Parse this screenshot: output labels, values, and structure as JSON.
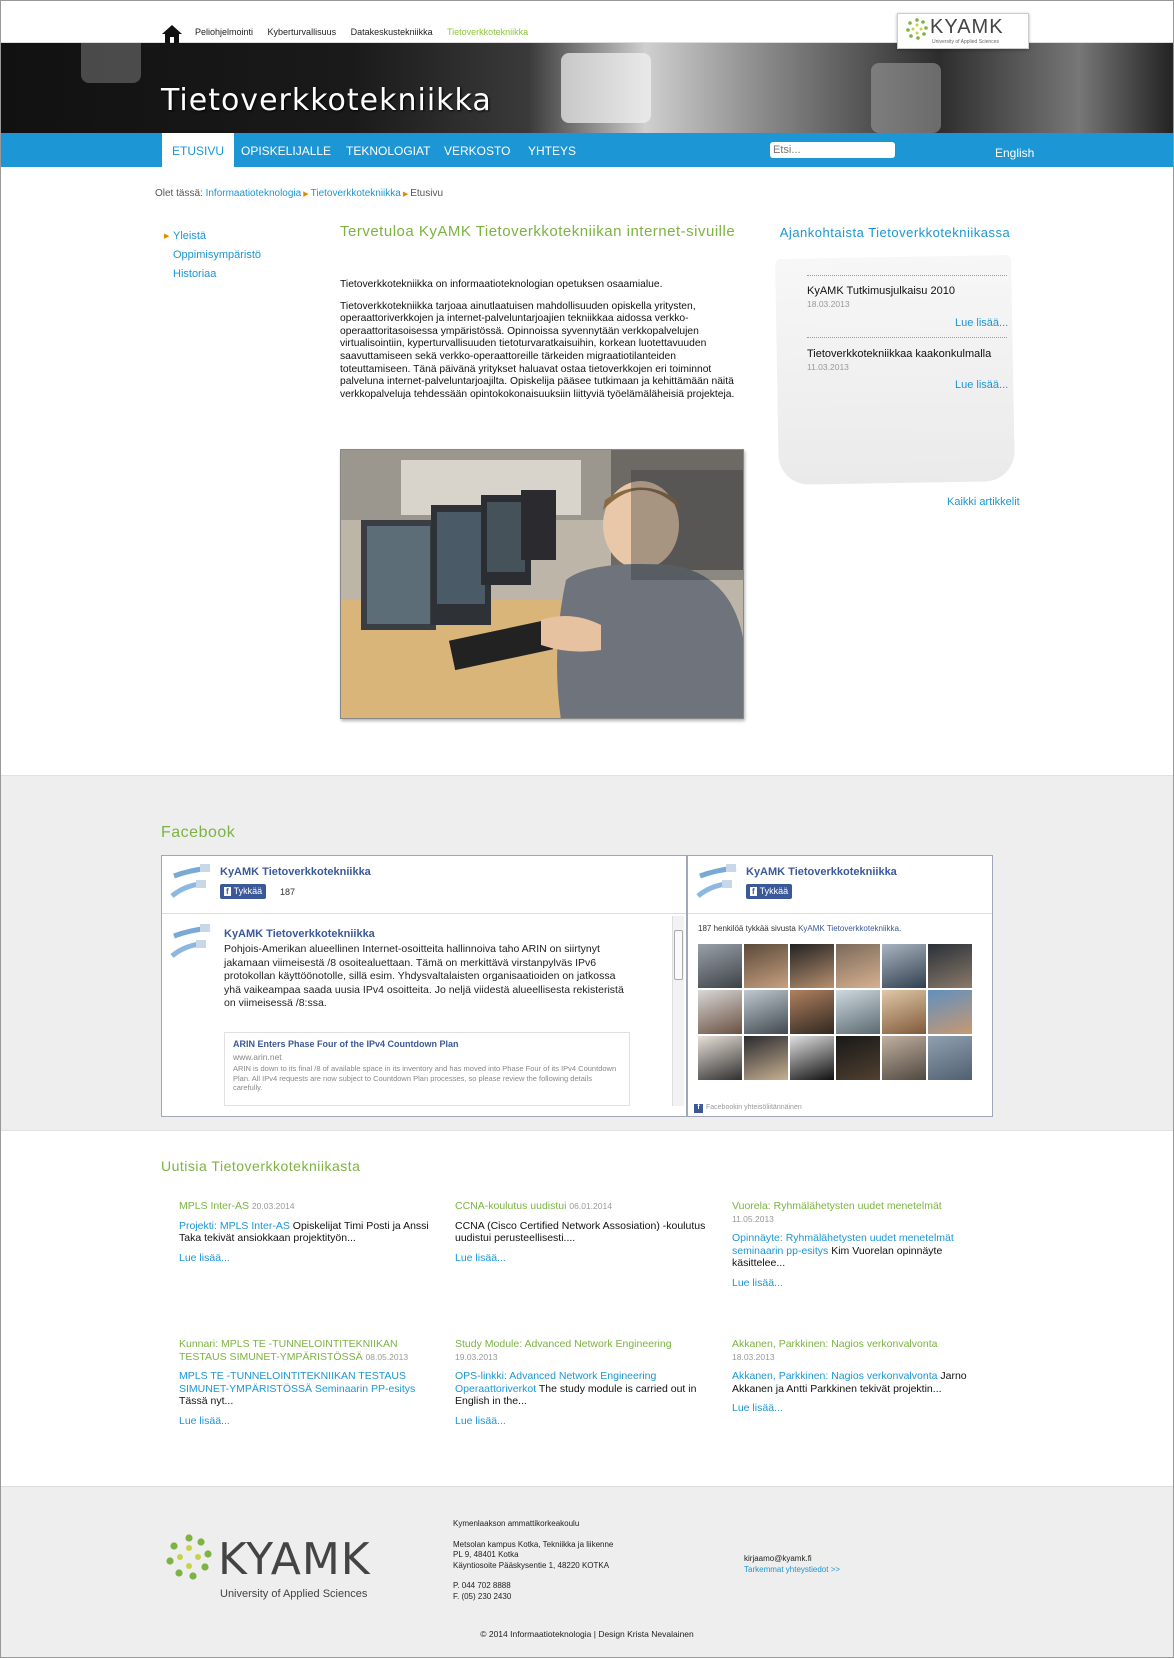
{
  "topnav": {
    "links": [
      "Peliohjelmointi",
      "Kyberturvallisuus",
      "Datakeskustekniikka",
      "Tietoverkkotekniikka"
    ],
    "active_index": 3
  },
  "logo": {
    "text": "KYAMK",
    "subtitle": "University of Applied Sciences"
  },
  "banner": {
    "title": "Tietoverkkotekniikka"
  },
  "mainnav": {
    "items": [
      "ETUSIVU",
      "OPISKELIJALLE",
      "TEKNOLOGIAT",
      "VERKOSTO",
      "YHTEYS"
    ],
    "search_placeholder": "Etsi...",
    "language": "English"
  },
  "breadcrumb": {
    "prefix": "Olet tässä:",
    "items": [
      "Informaatioteknologia",
      "Tietoverkkotekniikka",
      "Etusivu"
    ]
  },
  "sidemenu": [
    "Yleistä",
    "Oppimisympäristö",
    "Historiaa"
  ],
  "main": {
    "title": "Tervetuloa KyAMK Tietoverkkotekniikan internet-sivuille",
    "paragraphs": [
      "Tietoverkkotekniikka on informaatioteknologian opetuksen osaamialue.",
      "Tietoverkkotekniikka tarjoaa ainutlaatuisen mahdollisuuden opiskella yritysten, operaattoriverkkojen ja internet-palveluntarjoajien tekniikkaa aidossa verkko-operaattoritasoisessa ympäristössä. Opinnoissa syvennytään verkkopalvelujen virtualisointiin, kyperturvallisuuden tietoturvaratkaisuihin, korkean luotettavuuden saavuttamiseen sekä verkko-operaattoreille tärkeiden migraatiotilanteiden toteuttamiseen. Tänä päivänä yritykset haluavat ostaa tietoverkkojen eri toiminnot palveluna internet-palveluntarjoajilta.  Opiskelija pääsee tutkimaan ja kehittämään näitä verkkopalveluja tehdessään opintokokonaisuuksiin liittyviä työelämäläheisiä projekteja."
    ]
  },
  "current_news": {
    "title": "Ajankohtaista Tietoverkkotekniikassa",
    "items": [
      {
        "title": "KyAMK Tutkimusjulkaisu 2010",
        "date": "18.03.2013",
        "more": "Lue lisää..."
      },
      {
        "title": "Tietoverkkotekniikkaa kaakonkulmalla",
        "date": "11.03.2013",
        "more": "Lue lisää..."
      }
    ],
    "all_articles": "Kaikki artikkelit"
  },
  "facebook": {
    "heading": "Facebook",
    "page_name": "KyAMK Tietoverkkotekniikka",
    "like_label": "Tykkää",
    "like_count": "187",
    "post_text": "Pohjois-Amerikan alueellinen Internet-osoitteita hallinnoiva taho ARIN on siirtynyt jakamaan viimeisestä /8 osoitealuettaan. Tämä on merkittävä virstanpylväs IPv6 protokollan käyttöönotolle, sillä esim. Yhdysvaltalaisten organisaatioiden on jatkossa yhä vaikeampaa saada uusia IPv4 osoitteita. Jo neljä viidestä alueellisesta rekisteristä on viimeisessä /8:ssa.",
    "link_title": "ARIN Enters Phase Four of the IPv4 Countdown Plan",
    "link_url": "www.arin.net",
    "link_desc": "ARIN is down to its final /8 of available space in its inventory and has moved into Phase Four of its IPv4 Countdown Plan. All IPv4 requests are now subject to Countdown Plan processes, so please review the following details carefully.",
    "likers_prefix": "187 henkilöä tykkää sivusta",
    "likers_page": "KyAMK Tietoverkkotekniikka",
    "plugin_label": "Facebookin yhteisöliitännäinen"
  },
  "news": {
    "heading": "Uutisia Tietoverkkotekniikasta",
    "items": [
      {
        "title": "MPLS Inter-AS",
        "date": "20.03.2014",
        "link": "Projekti: MPLS Inter-AS",
        "text": "Opiskelijat Timi Posti ja Anssi Taka tekivät ansiokkaan projektityön...",
        "more": "Lue lisää..."
      },
      {
        "title": "CCNA-koulutus uudistui",
        "date": "06.01.2014",
        "link": "",
        "text": "CCNA (Cisco Certified Network Assosiation) -koulutus uudistui perusteellisesti....",
        "more": "Lue lisää..."
      },
      {
        "title": "Vuorela: Ryhmälähetysten uudet menetelmät",
        "date": "11.05.2013",
        "link": "Opinnäyte: Ryhmälähetysten uudet menetelmät seminaarin pp-esitys",
        "text": "Kim Vuorelan opinnäyte käsittelee...",
        "more": "Lue lisää..."
      },
      {
        "title": "Kunnari: MPLS TE -TUNNELOINTITEKNIIKAN TESTAUS SIMUNET-YMPÄRISTÖSSÄ",
        "date": "08.05.2013",
        "link": "MPLS TE -TUNNELOINTITEKNIIKAN TESTAUS SIMUNET-YMPÄRISTÖSSÄ Seminaarin PP-esitys",
        "text": "Tässä nyt...",
        "more": "Lue lisää..."
      },
      {
        "title": "Study Module: Advanced Network Engineering",
        "date": "19.03.2013",
        "link": "OPS-linkki: Advanced Network Engineering Operaattoriverkot",
        "text": "The study module is carried out in English in the...",
        "more": "Lue lisää..."
      },
      {
        "title": "Akkanen, Parkkinen: Nagios verkonvalvonta",
        "date": "18.03.2013",
        "link": "Akkanen, Parkkinen: Nagios verkonvalvonta",
        "text": "Jarno Akkanen ja Antti Parkkinen tekivät projektin...",
        "more": "Lue lisää..."
      }
    ]
  },
  "footer": {
    "org": "Kymenlaakson ammattikorkeakoulu",
    "address": [
      "Metsolan kampus Kotka, Tekniikka ja liikenne",
      "PL 9, 48401 Kotka",
      "Käyntiosoite Pääskysentie 1, 48220 KOTKA"
    ],
    "phone": "P. 044 702 8888",
    "fax": "F. (05) 230 2430",
    "email": "kirjaamo@kyamk.fi",
    "contact_link": "Tarkemmat yhteystiedot >>",
    "copyright": "© 2014 Informaatioteknologia | Design Krista Nevalainen"
  },
  "colors": {
    "accent_blue": "#1c96d4",
    "accent_green": "#7cb342",
    "facebook_blue": "#3b5998"
  }
}
